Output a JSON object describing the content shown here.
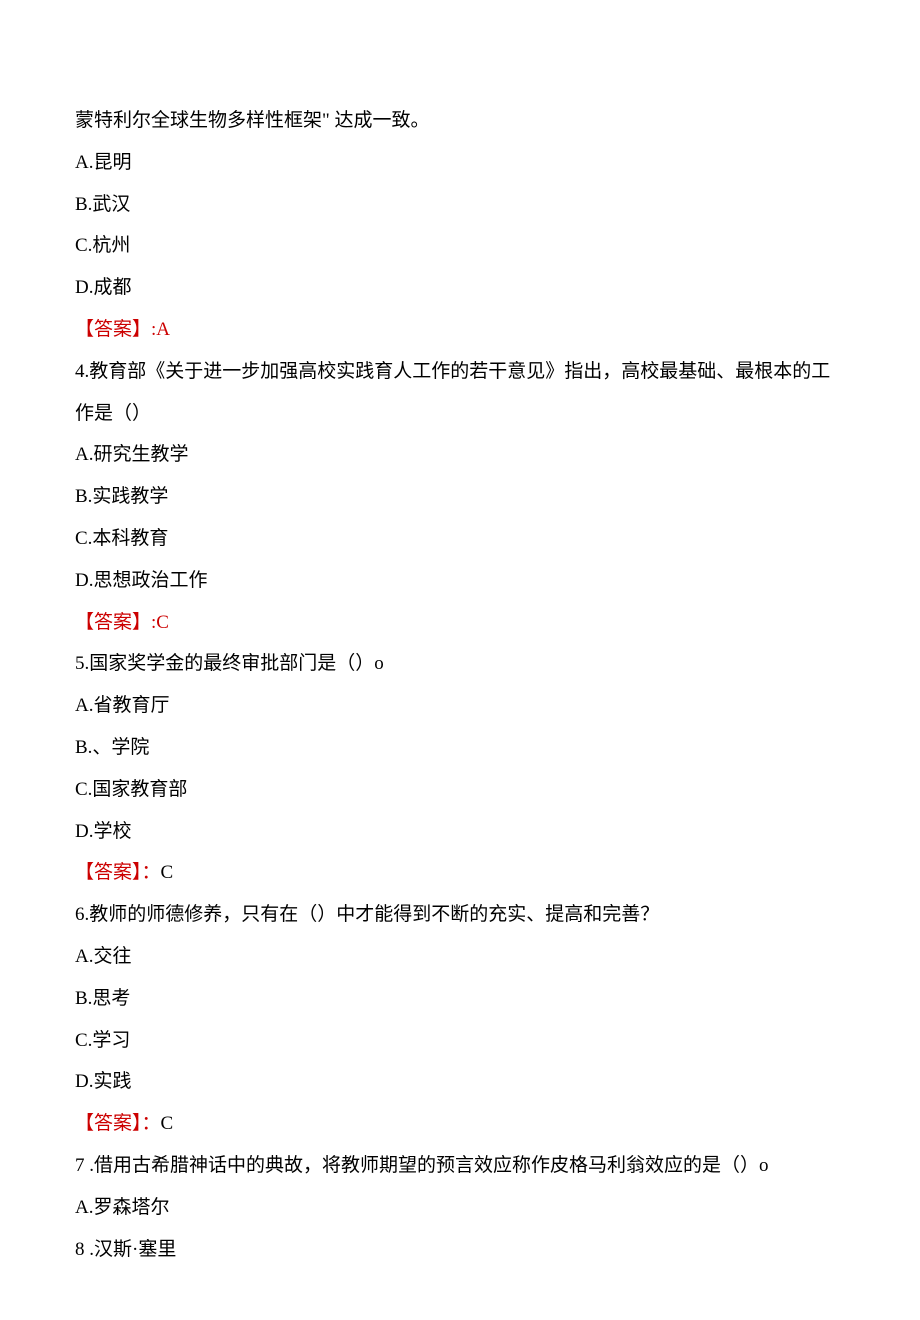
{
  "continuation": "蒙特利尔全球生物多样性框架\" 达成一致。",
  "q3_options": {
    "a": "A.昆明",
    "b": "B.武汉",
    "c": "C.杭州",
    "d": "D.成都"
  },
  "q3_answer_label": "【答案】",
  "q3_answer_value": ":A",
  "q4": {
    "stem1": "4.教育部《关于进一步加强高校实践育人工作的若干意见》指出，高校最基础、最根本的工",
    "stem2": "作是（）",
    "a": "A.研究生教学",
    "b": "B.实践教学",
    "c": "C.本科教育",
    "d": "D.思想政治工作",
    "answer_label": "【答案】",
    "answer_value": ":C"
  },
  "q5": {
    "stem": "5.国家奖学金的最终审批部门是（）o",
    "a": "A.省教育厅",
    "b": "B.、学院",
    "c": "C.国家教育部",
    "d": "D.学校",
    "answer_label": "【答案】：",
    "answer_value": "C"
  },
  "q6": {
    "stem": "6.教师的师德修养，只有在（）中才能得到不断的充实、提高和完善？",
    "a": "A.交往",
    "b": "B.思考",
    "c": "C.学习",
    "d": "D.实践",
    "answer_label": "【答案】：",
    "answer_value": "C"
  },
  "q7": {
    "stem": "7 .借用古希腊神话中的典故，将教师期望的预言效应称作皮格马利翁效应的是（）o",
    "a": "A.罗森塔尔"
  },
  "q8_partial": "8 .汉斯·塞里"
}
